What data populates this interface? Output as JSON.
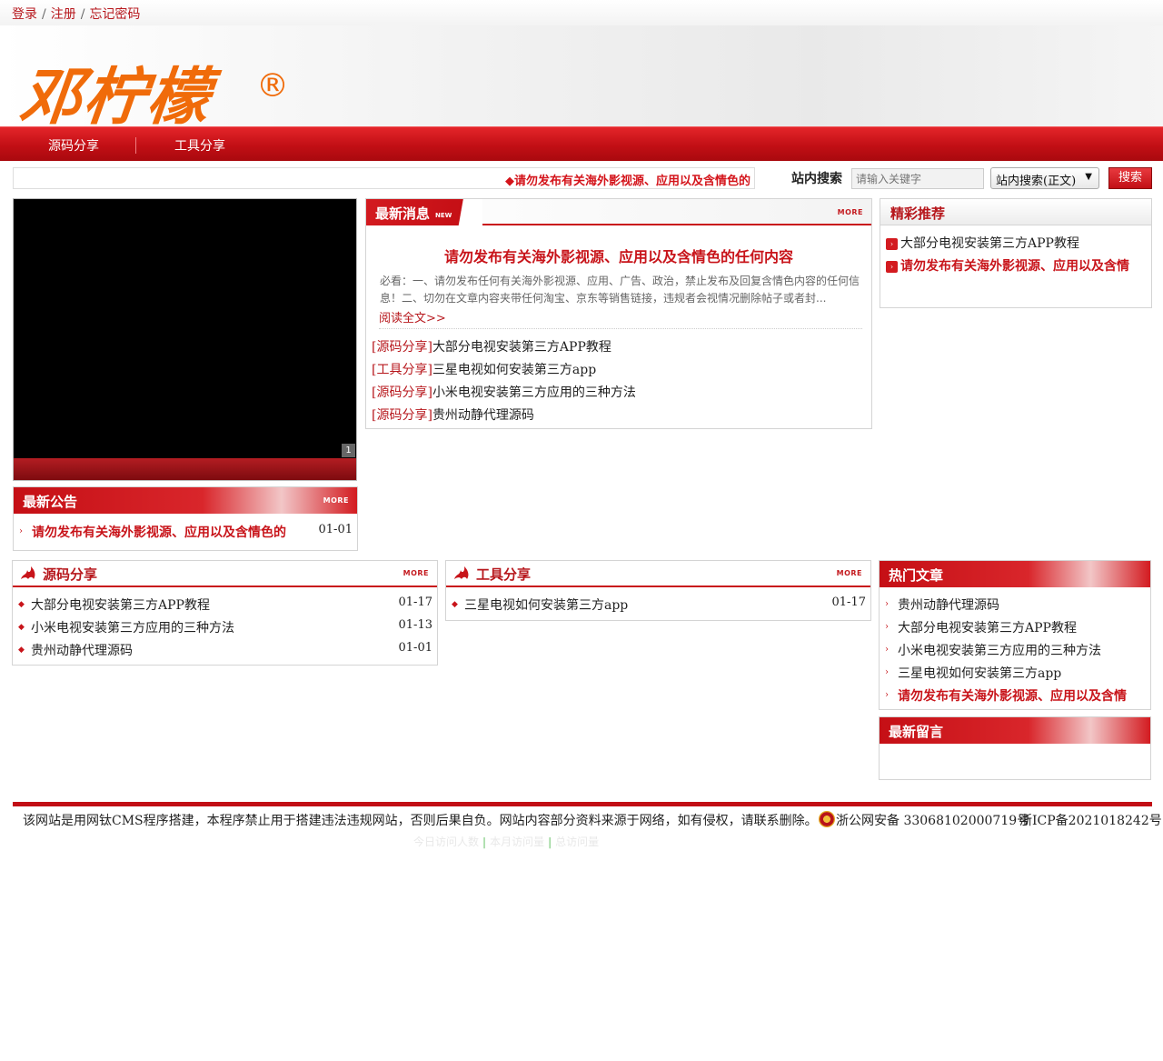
{
  "toplinks": {
    "login": "登录",
    "register": "注册",
    "forgot": "忘记密码",
    "sep": "/"
  },
  "logo": {
    "text": "邓柠檬",
    "reg": "®"
  },
  "nav": [
    "源码分享",
    "工具分享"
  ],
  "ticker": "◆请勿发布有关海外影视源、应用以及含情色的",
  "search": {
    "label": "站内搜索",
    "placeholder": "请输入关键字",
    "select": "站内搜索(正文)",
    "button": "搜索"
  },
  "slider": {
    "index": "1"
  },
  "news": {
    "title": "最新消息",
    "badge": "NEW",
    "more": "MORE",
    "headline": "请勿发布有关海外影视源、应用以及含情色的任何内容",
    "summary": "必看：一、请勿发布任何有关海外影视源、应用、广告、政治，禁止发布及回复含情色内容的任何信息！二、切勿在文章内容夹带任何淘宝、京东等销售链接，违规者会视情况删除帖子或者封...",
    "readmore": "阅读全文>>",
    "items": [
      {
        "cat": "[源码分享]",
        "title": "大部分电视安装第三方APP教程"
      },
      {
        "cat": "[工具分享]",
        "title": "三星电视如何安装第三方app"
      },
      {
        "cat": "[源码分享]",
        "title": "小米电视安装第三方应用的三种方法"
      },
      {
        "cat": "[源码分享]",
        "title": "贵州动静代理源码"
      }
    ]
  },
  "recommend": {
    "title": "精彩推荐",
    "items": [
      "大部分电视安装第三方APP教程",
      "请勿发布有关海外影视源、应用以及含情"
    ]
  },
  "notice": {
    "title": "最新公告",
    "more": "MORE",
    "items": [
      {
        "title": "请勿发布有关海外影视源、应用以及含情色的",
        "date": "01-01"
      }
    ]
  },
  "source": {
    "title": "源码分享",
    "more": "MORE",
    "items": [
      {
        "title": "大部分电视安装第三方APP教程",
        "date": "01-17"
      },
      {
        "title": "小米电视安装第三方应用的三种方法",
        "date": "01-13"
      },
      {
        "title": "贵州动静代理源码",
        "date": "01-01"
      }
    ]
  },
  "tools": {
    "title": "工具分享",
    "more": "MORE",
    "items": [
      {
        "title": "三星电视如何安装第三方app",
        "date": "01-17"
      }
    ]
  },
  "hot": {
    "title": "热门文章",
    "items": [
      "贵州动静代理源码",
      "大部分电视安装第三方APP教程",
      "小米电视安装第三方应用的三种方法",
      "三星电视如何安装第三方app",
      "请勿发布有关海外影视源、应用以及含情"
    ]
  },
  "comments": {
    "title": "最新留言"
  },
  "footer": {
    "text": "该网站是用网钛CMS程序搭建，本程序禁止用于搭建违法违规网站，否则后果自负。网站内容部分资料来源于网络，如有侵权，请联系删除。",
    "police": "浙公网安备  33068102000719号",
    "icp": "浙ICP备2021018242号",
    "stats": [
      "今日访问人数",
      "本月访问量",
      "总访问量"
    ]
  },
  "colors": {
    "brand": "#c20f15",
    "logo": "#f06b0a",
    "link": "#b7171c"
  }
}
